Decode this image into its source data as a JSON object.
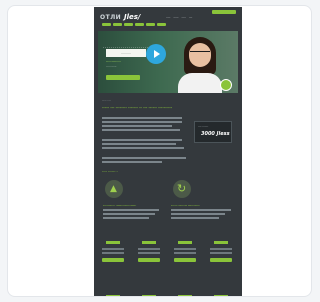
{
  "header": {
    "logo": "ОТЛИ",
    "logo_accent": "Jles/",
    "nav_links": [
      "-----",
      "------",
      "-----",
      "----"
    ]
  },
  "hero": {
    "title": "..........",
    "sub1": ".............",
    "sub2": "..........."
  },
  "content": {
    "breadcrumb": "-----  ----",
    "heading": "----- --- -------- ------- -- --- ------ ----------",
    "side_label": "---- -------",
    "side_value": "3000 Jless",
    "subhead": "---- ------ -"
  },
  "features": [
    {
      "icon": "thumbs-up-icon",
      "title": "----------- -------------------"
    },
    {
      "icon": "refresh-icon",
      "title": "------ -------- -----------"
    }
  ],
  "colors": {
    "accent": "#8ac43a",
    "page_bg": "#34393d",
    "cta_blue": "#2ea7dd"
  }
}
